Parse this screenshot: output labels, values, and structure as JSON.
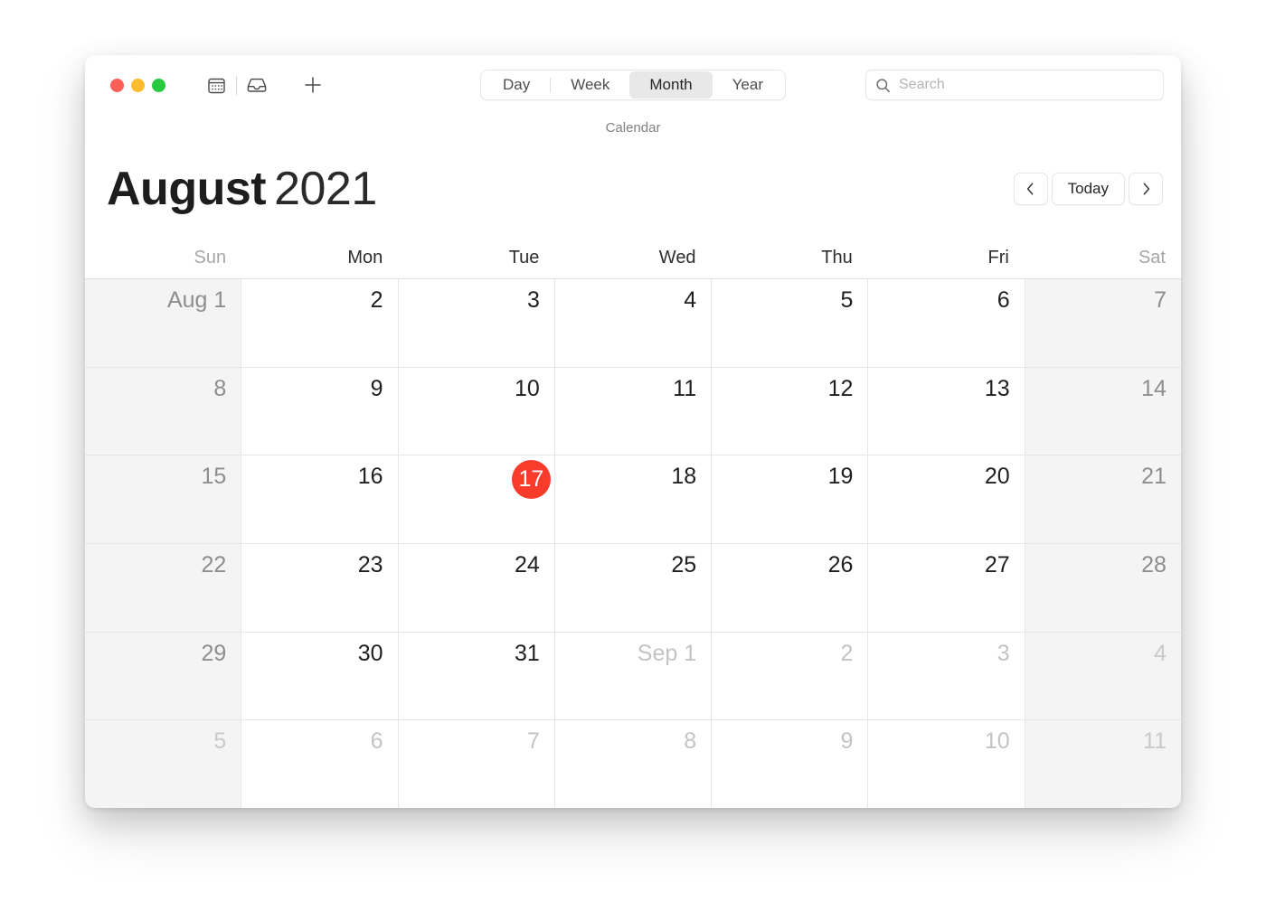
{
  "window": {
    "subtitle": "Calendar",
    "traffic_lights": [
      {
        "name": "close",
        "color": "#FF5F56"
      },
      {
        "name": "minimize",
        "color": "#FEBC2E"
      },
      {
        "name": "maximize",
        "color": "#28C840"
      }
    ]
  },
  "toolbar": {
    "icons": [
      {
        "name": "calendar-icon",
        "label": "Calendar"
      },
      {
        "name": "inbox-icon",
        "label": "Inbox"
      },
      {
        "name": "plus-icon",
        "label": "New Event"
      }
    ],
    "view_modes": [
      {
        "label": "Day",
        "selected": false
      },
      {
        "label": "Week",
        "selected": false
      },
      {
        "label": "Month",
        "selected": true
      },
      {
        "label": "Year",
        "selected": false
      }
    ],
    "search": {
      "icon": "search-icon",
      "placeholder": "Search",
      "value": ""
    }
  },
  "header": {
    "month": "August",
    "year": "2021",
    "nav": {
      "previous_icon": "chevron-left-icon",
      "today_label": "Today",
      "next_icon": "chevron-right-icon"
    }
  },
  "calendar": {
    "accent_color": "#F93B2C",
    "weekend_background": "#F4F4F4",
    "weekdays": [
      {
        "label": "Sun",
        "weekend": true
      },
      {
        "label": "Mon",
        "weekend": false
      },
      {
        "label": "Tue",
        "weekend": false
      },
      {
        "label": "Wed",
        "weekend": false
      },
      {
        "label": "Thu",
        "weekend": false
      },
      {
        "label": "Fri",
        "weekend": false
      },
      {
        "label": "Sat",
        "weekend": true
      }
    ],
    "weeks": [
      [
        {
          "label": "Aug 1",
          "weekend": true,
          "outside": false,
          "today": false
        },
        {
          "label": "2",
          "weekend": false,
          "outside": false,
          "today": false
        },
        {
          "label": "3",
          "weekend": false,
          "outside": false,
          "today": false
        },
        {
          "label": "4",
          "weekend": false,
          "outside": false,
          "today": false
        },
        {
          "label": "5",
          "weekend": false,
          "outside": false,
          "today": false
        },
        {
          "label": "6",
          "weekend": false,
          "outside": false,
          "today": false
        },
        {
          "label": "7",
          "weekend": true,
          "outside": false,
          "today": false
        }
      ],
      [
        {
          "label": "8",
          "weekend": true,
          "outside": false,
          "today": false
        },
        {
          "label": "9",
          "weekend": false,
          "outside": false,
          "today": false
        },
        {
          "label": "10",
          "weekend": false,
          "outside": false,
          "today": false
        },
        {
          "label": "11",
          "weekend": false,
          "outside": false,
          "today": false
        },
        {
          "label": "12",
          "weekend": false,
          "outside": false,
          "today": false
        },
        {
          "label": "13",
          "weekend": false,
          "outside": false,
          "today": false
        },
        {
          "label": "14",
          "weekend": true,
          "outside": false,
          "today": false
        }
      ],
      [
        {
          "label": "15",
          "weekend": true,
          "outside": false,
          "today": false
        },
        {
          "label": "16",
          "weekend": false,
          "outside": false,
          "today": false
        },
        {
          "label": "17",
          "weekend": false,
          "outside": false,
          "today": true
        },
        {
          "label": "18",
          "weekend": false,
          "outside": false,
          "today": false
        },
        {
          "label": "19",
          "weekend": false,
          "outside": false,
          "today": false
        },
        {
          "label": "20",
          "weekend": false,
          "outside": false,
          "today": false
        },
        {
          "label": "21",
          "weekend": true,
          "outside": false,
          "today": false
        }
      ],
      [
        {
          "label": "22",
          "weekend": true,
          "outside": false,
          "today": false
        },
        {
          "label": "23",
          "weekend": false,
          "outside": false,
          "today": false
        },
        {
          "label": "24",
          "weekend": false,
          "outside": false,
          "today": false
        },
        {
          "label": "25",
          "weekend": false,
          "outside": false,
          "today": false
        },
        {
          "label": "26",
          "weekend": false,
          "outside": false,
          "today": false
        },
        {
          "label": "27",
          "weekend": false,
          "outside": false,
          "today": false
        },
        {
          "label": "28",
          "weekend": true,
          "outside": false,
          "today": false
        }
      ],
      [
        {
          "label": "29",
          "weekend": true,
          "outside": false,
          "today": false
        },
        {
          "label": "30",
          "weekend": false,
          "outside": false,
          "today": false
        },
        {
          "label": "31",
          "weekend": false,
          "outside": false,
          "today": false
        },
        {
          "label": "Sep 1",
          "weekend": false,
          "outside": true,
          "today": false
        },
        {
          "label": "2",
          "weekend": false,
          "outside": true,
          "today": false
        },
        {
          "label": "3",
          "weekend": false,
          "outside": true,
          "today": false
        },
        {
          "label": "4",
          "weekend": true,
          "outside": true,
          "today": false
        }
      ],
      [
        {
          "label": "5",
          "weekend": true,
          "outside": true,
          "today": false
        },
        {
          "label": "6",
          "weekend": false,
          "outside": true,
          "today": false
        },
        {
          "label": "7",
          "weekend": false,
          "outside": true,
          "today": false
        },
        {
          "label": "8",
          "weekend": false,
          "outside": true,
          "today": false
        },
        {
          "label": "9",
          "weekend": false,
          "outside": true,
          "today": false
        },
        {
          "label": "10",
          "weekend": false,
          "outside": true,
          "today": false
        },
        {
          "label": "11",
          "weekend": true,
          "outside": true,
          "today": false
        }
      ]
    ]
  }
}
